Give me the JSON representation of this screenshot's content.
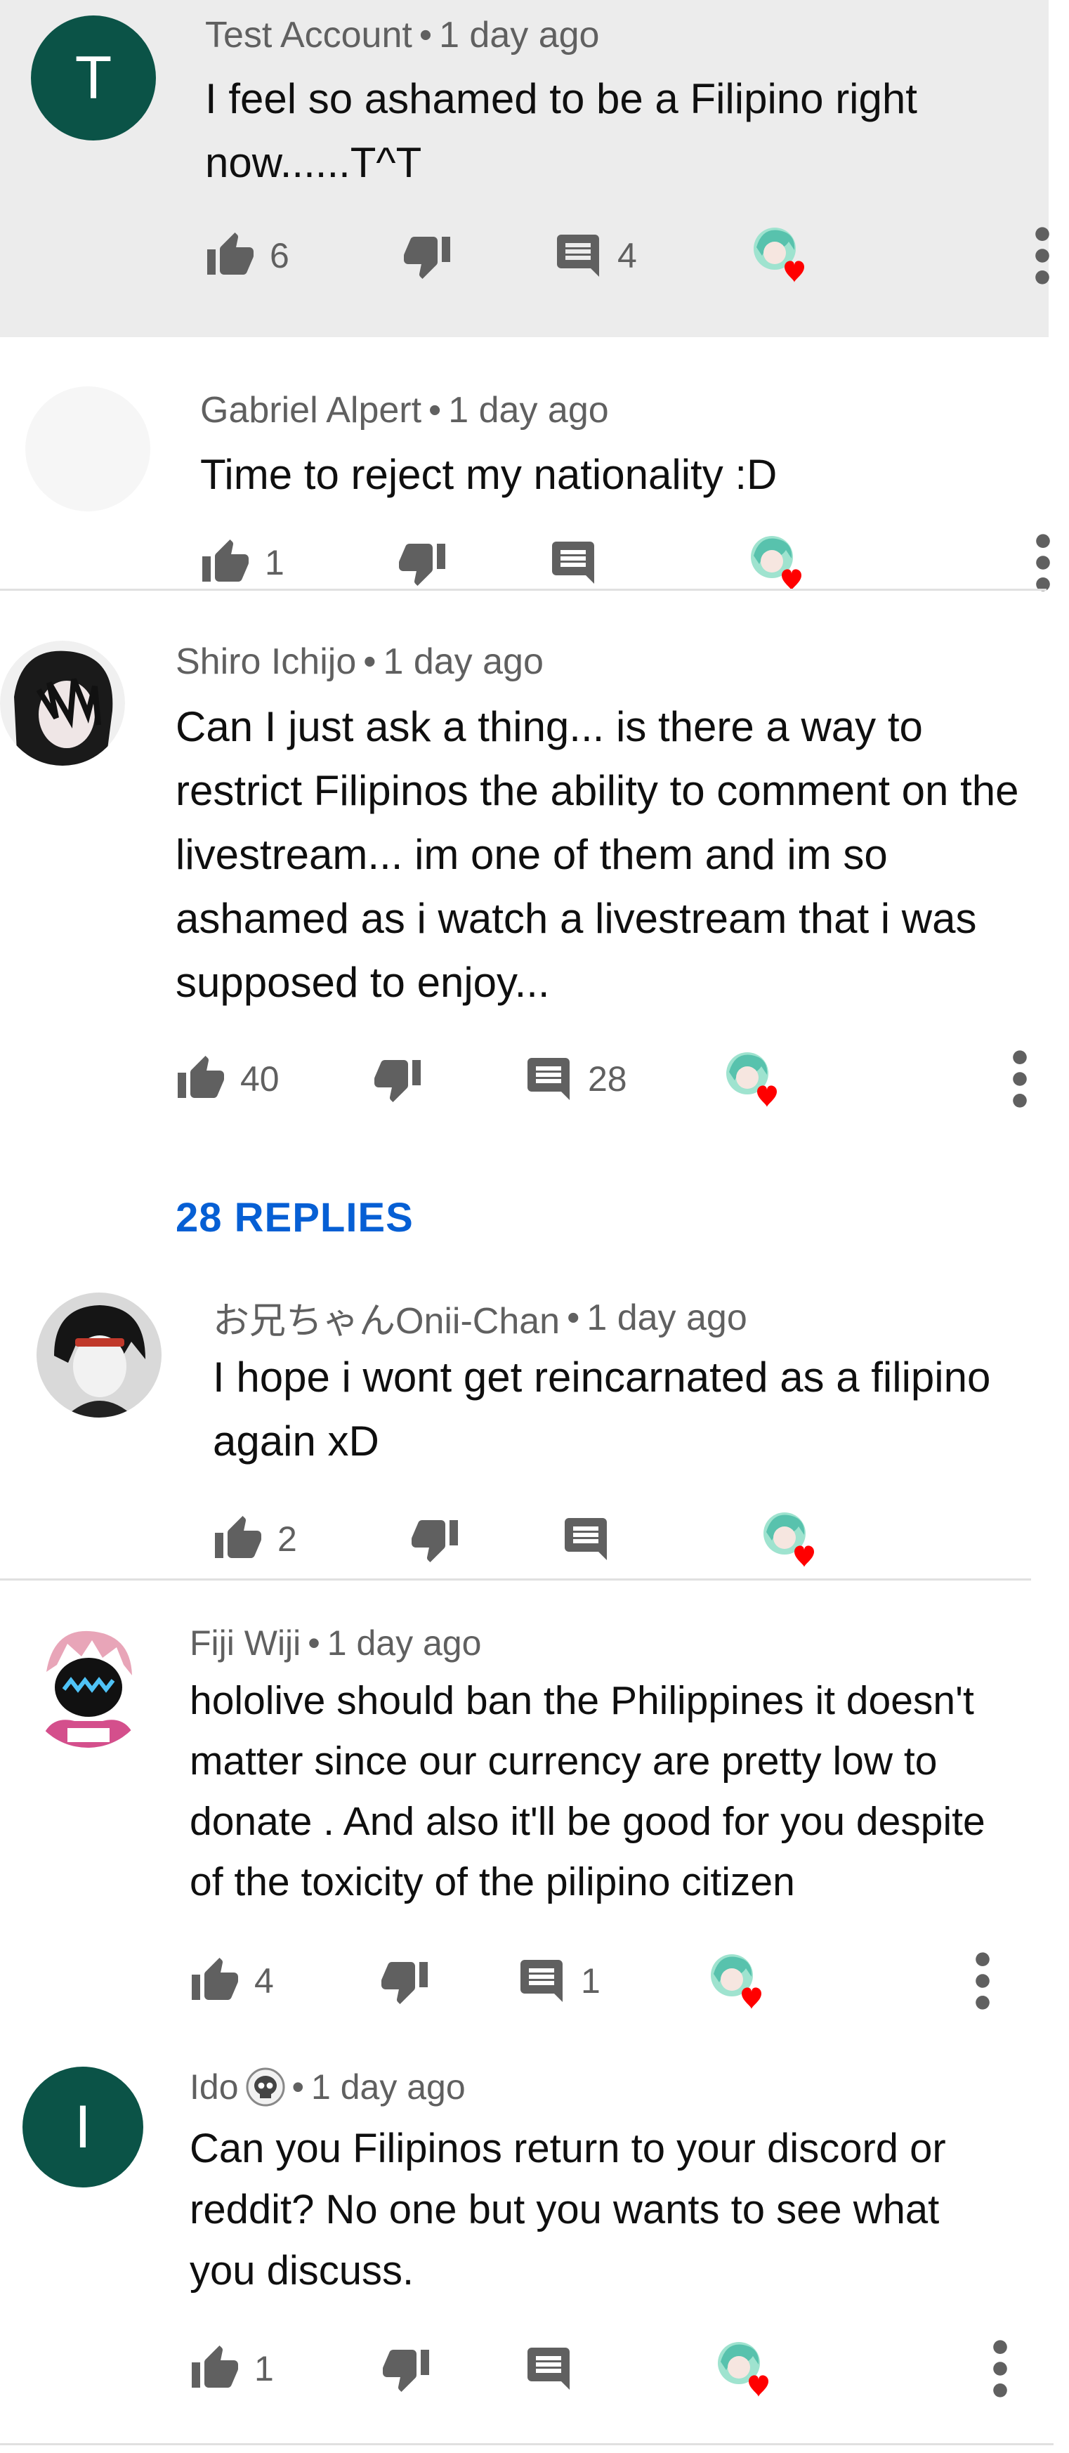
{
  "comments": [
    {
      "author": "Test Account",
      "time": "1 day ago",
      "avatar_letter": "T",
      "text": "I feel so ashamed to be a Filipino right now......T^T",
      "likes": "6",
      "replies": "4"
    },
    {
      "author": "Gabriel Alpert",
      "time": "1 day ago",
      "text": "Time to reject my nationality :D",
      "likes": "1",
      "replies": ""
    },
    {
      "author": "Shiro Ichijo",
      "time": "1 day ago",
      "text": "Can I just ask a thing... is there a way to restrict Filipinos the ability to comment on the livestream... im one of them and im so ashamed as i watch a livestream that i was supposed to enjoy...",
      "likes": "40",
      "replies": "28",
      "replies_link": "28 REPLIES"
    },
    {
      "author": "お兄ちゃんOnii-Chan",
      "time": "1 day ago",
      "text": "I hope i wont get reincarnated as a filipino again xD",
      "likes": "2",
      "replies": ""
    },
    {
      "author": "Fiji Wiji",
      "time": "1 day ago",
      "text": "hololive should ban the Philippines it doesn't matter since our currency are pretty low to donate . And also it'll be good for you despite of the toxicity of the pilipino citizen",
      "likes": "4",
      "replies": "1"
    },
    {
      "author": "Ido",
      "time": "1 day ago",
      "avatar_letter": "I",
      "text": "Can you Filipinos return to your discord or reddit? No one but you wants to see what you discuss.",
      "likes": "1",
      "replies": ""
    }
  ],
  "separator": "•",
  "icons": {
    "like": "thumb-up-icon",
    "dislike": "thumb-down-icon",
    "reply": "comment-icon",
    "hearted": "creator-heart-icon",
    "more": "more-vert-icon"
  },
  "colors": {
    "avatar_green": "#0b5347",
    "link_blue": "#065fd4",
    "highlight_bg": "#ececec",
    "heart_red": "#ff0000"
  }
}
